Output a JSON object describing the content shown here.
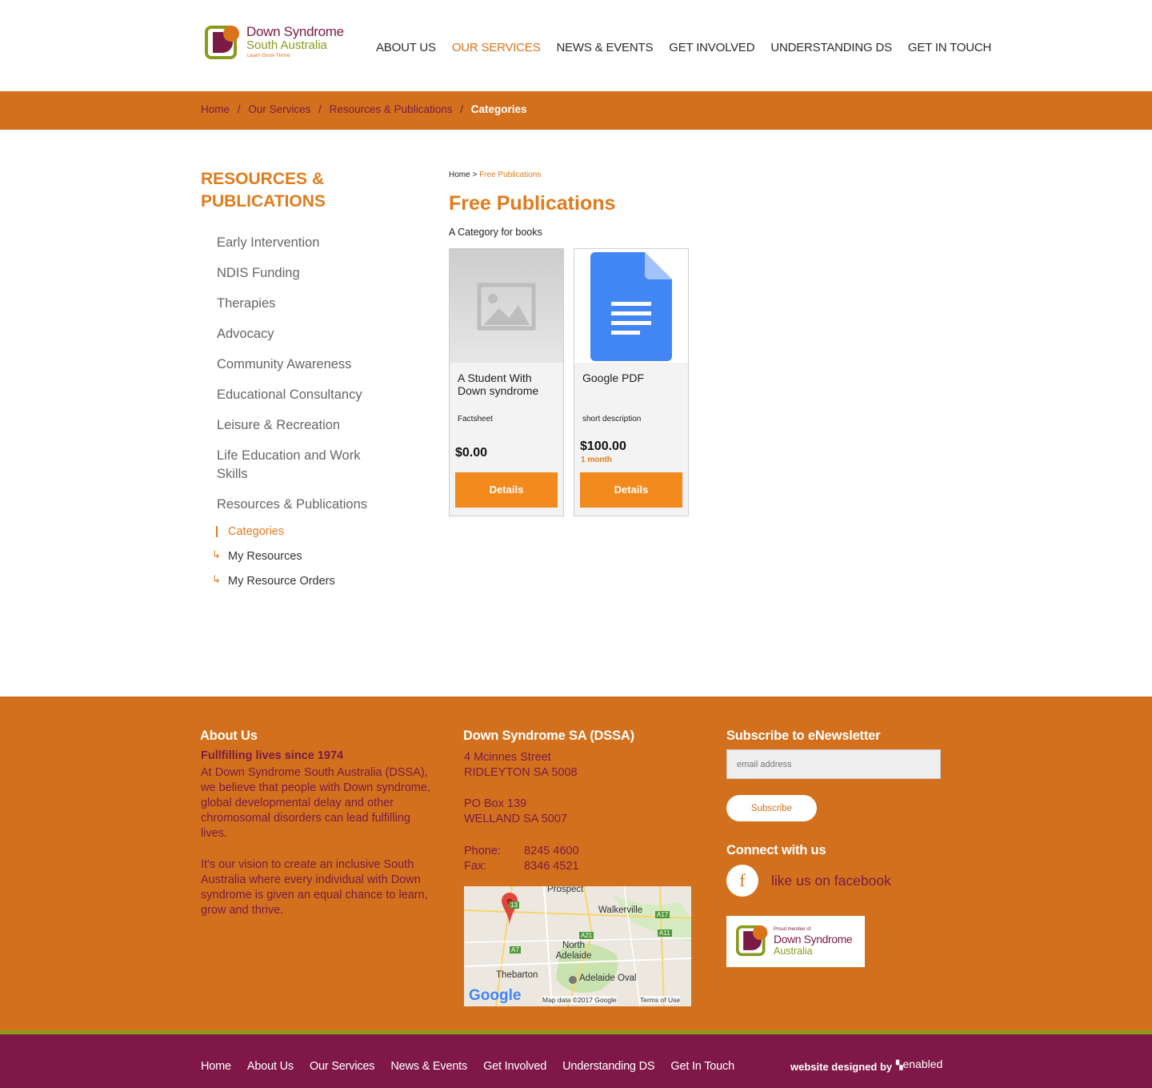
{
  "header": {
    "logo": {
      "line1": "Down Syndrome",
      "line2": "South Australia",
      "tagline": "Learn Grow Thrive"
    },
    "nav": [
      {
        "label": "ABOUT US",
        "active": false
      },
      {
        "label": "OUR SERVICES",
        "active": true
      },
      {
        "label": "NEWS & EVENTS",
        "active": false
      },
      {
        "label": "GET INVOLVED",
        "active": false
      },
      {
        "label": "UNDERSTANDING DS",
        "active": false
      },
      {
        "label": "GET IN TOUCH",
        "active": false
      }
    ]
  },
  "breadcrumb": {
    "items": [
      "Home",
      "Our Services",
      "Resources & Publications"
    ],
    "current": "Categories",
    "separator": "/"
  },
  "sidebar": {
    "title": "RESOURCES & PUBLICATIONS",
    "items": [
      "Early Intervention",
      "NDIS Funding",
      "Therapies",
      "Advocacy",
      "Community Awareness",
      "Educational Consultancy",
      "Leisure & Recreation",
      "Life Education and Work Skills",
      "Resources & Publications"
    ],
    "subitems": [
      {
        "label": "Categories",
        "active": true
      },
      {
        "label": "My Resources",
        "active": false
      },
      {
        "label": "My Resource Orders",
        "active": false
      }
    ]
  },
  "main": {
    "mini_breadcrumb": {
      "home": "Home >",
      "current": "Free Publications"
    },
    "title": "Free Publications",
    "description": "A Category for books",
    "products": [
      {
        "name": "A Student With Down syndrome",
        "description": "Factsheet",
        "price": "$0.00",
        "period": "",
        "button": "Details",
        "image": "image-placeholder-icon"
      },
      {
        "name": "Google PDF",
        "description": "short description",
        "price": "$100.00",
        "period": "1 month",
        "button": "Details",
        "image": "google-doc-icon"
      }
    ]
  },
  "footer": {
    "about": {
      "heading": "About Us",
      "subheading": "Fullfilling lives since 1974",
      "para1": "At Down Syndrome South Australia (DSSA), we believe that people with Down syndrome, global developmental delay and other chromosomal disorders can lead fulfilling lives.",
      "para2": "It's our vision to create an inclusive South Australia where every individual with Down syndrome is given an equal chance to learn, grow and thrive."
    },
    "contact": {
      "heading": "Down Syndrome SA (DSSA)",
      "street": "4 Mcinnes Street",
      "suburb": "RIDLEYTON SA 5008",
      "pobox": "PO Box 139",
      "pobox_suburb": "WELLAND SA 5007",
      "phone_label": "Phone:",
      "phone": "8245 4600",
      "fax_label": "Fax:",
      "fax": "8346 4521",
      "map": {
        "labels": [
          "Prospect",
          "Walkerville",
          "North Adelaide",
          "Thebarton",
          "Adelaide Oval"
        ],
        "roads": [
          "A17",
          "A11",
          "A21",
          "A7",
          "13"
        ],
        "google": "Google",
        "attribution": "Map data ©2017 Google",
        "terms": "Terms of Use"
      }
    },
    "newsletter": {
      "heading": "Subscribe to eNewsletter",
      "placeholder": "email address",
      "button": "Subscribe",
      "connect_heading": "Connect with us",
      "facebook": "like us on facebook",
      "badge_line0": "Proud member of",
      "badge_line1": "Down Syndrome",
      "badge_line2": "Australia"
    }
  },
  "bottom_bar": {
    "links": [
      "Home",
      "About Us",
      "Our Services",
      "News & Events",
      "Get Involved",
      "Understanding DS",
      "Get In Touch"
    ],
    "credit": "website designed by",
    "brand": "enabled"
  },
  "colors": {
    "orange": "#d2701d",
    "accent": "#e07b1c",
    "plum": "#7f1848",
    "olive": "#8a9a1b"
  }
}
